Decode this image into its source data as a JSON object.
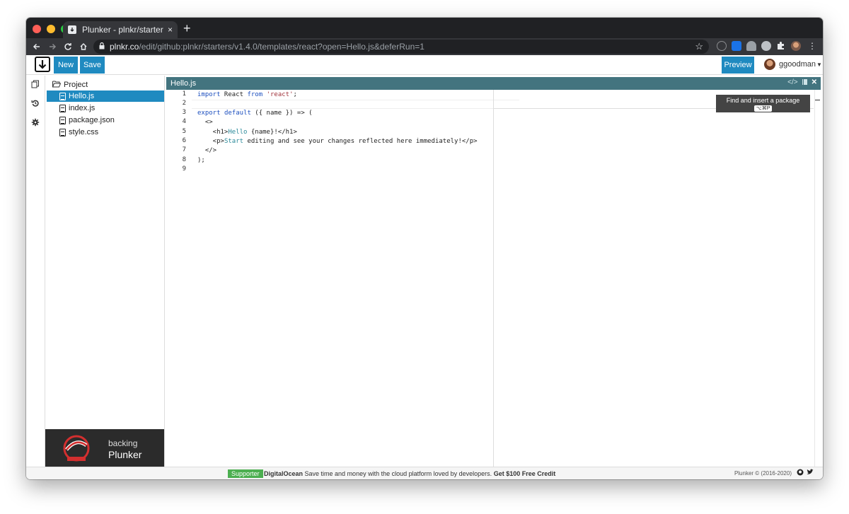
{
  "browser": {
    "tab_title": "Plunker - plnkr/starters: Starte",
    "tab_close": "×",
    "new_tab": "+",
    "url_host": "plnkr.co",
    "url_path": "/edit/github:plnkr/starters/v1.4.0/templates/react?open=Hello.js&deferRun=1",
    "extension_colors": [
      "#5f6368",
      "#1a73e8",
      "#9aa0a6",
      "#bdc1c6",
      "#e8eaed",
      "#7c5a4a"
    ]
  },
  "header": {
    "new_label": "New",
    "save_label": "Save",
    "preview_label": "Preview",
    "username": "ggoodman"
  },
  "tree": {
    "root": "Project",
    "files": [
      "Hello.js",
      "index.js",
      "package.json",
      "style.css"
    ],
    "active": "Hello.js"
  },
  "sponsor": {
    "line1": "backing",
    "line2": "Plunker"
  },
  "editor": {
    "file_title": "Hello.js",
    "line_numbers": [
      "1",
      "2",
      "3",
      "4",
      "5",
      "6",
      "7",
      "8",
      "9"
    ]
  },
  "tooltip": {
    "text": "Find and insert a package",
    "shortcut": "⌥⌘P"
  },
  "footer": {
    "supporter": "Supporter",
    "sponsor_name": "DigitalOcean",
    "ad_text": "Save time and money with the cloud platform loved by developers.",
    "ad_cta": "Get $100 Free Credit",
    "copyright": "Plunker © (2016-2020)"
  },
  "colors": {
    "accent": "#1f8ac0",
    "editor_header": "#43747f",
    "supporter_green": "#4caf50"
  }
}
